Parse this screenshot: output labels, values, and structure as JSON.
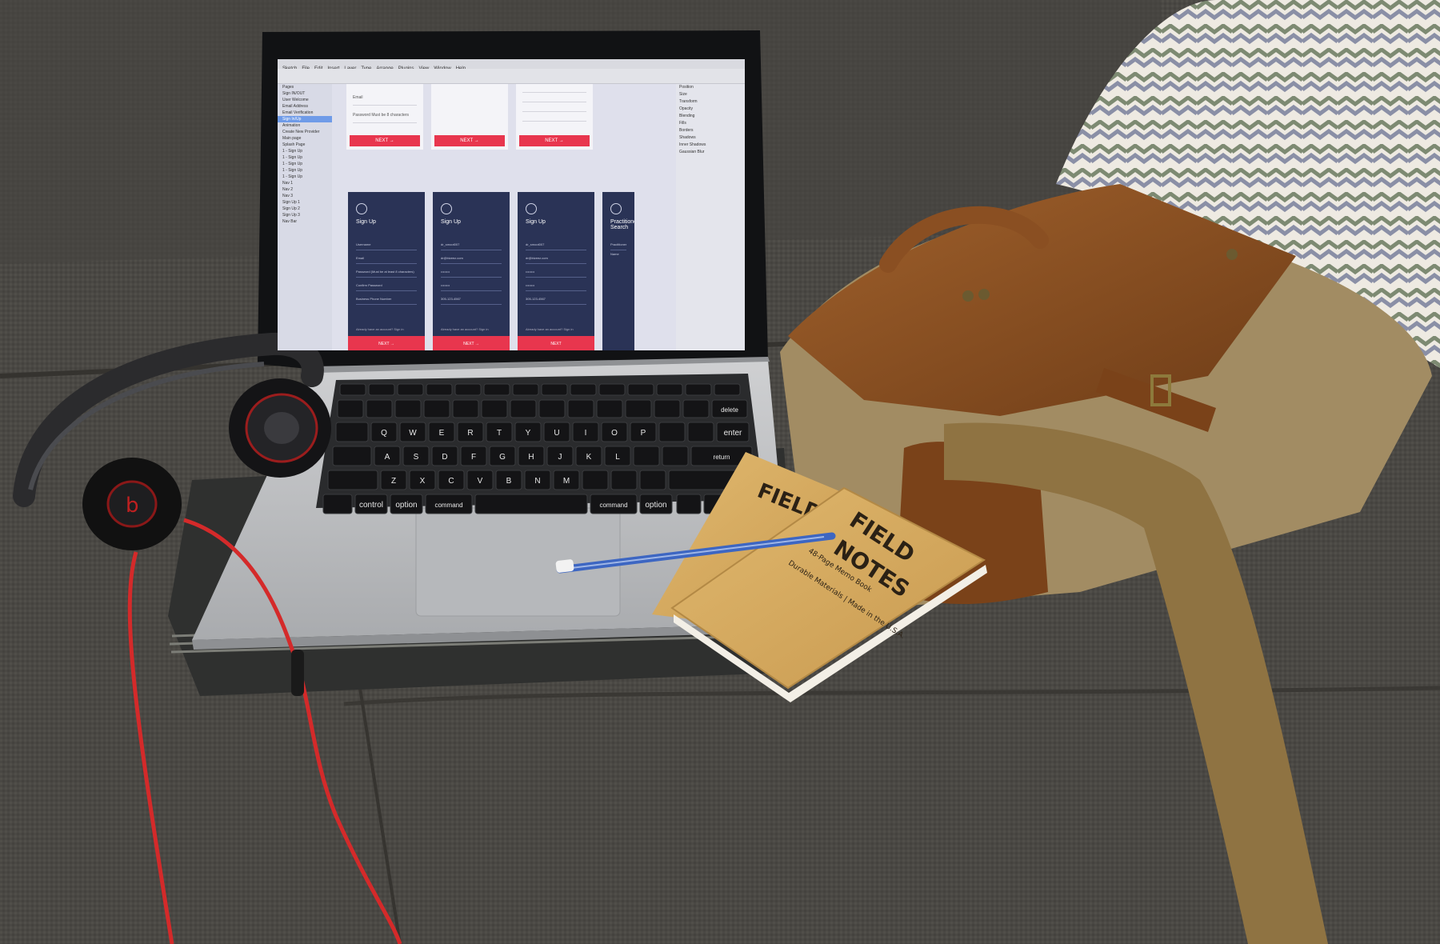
{
  "menubar": {
    "items": [
      "Sketch",
      "File",
      "Edit",
      "Insert",
      "Layer",
      "Type",
      "Arrange",
      "Plugins",
      "View",
      "Window",
      "Help"
    ]
  },
  "layers_panel": {
    "rows": [
      "Pages",
      "Sign IN/OUT",
      "User Welcome",
      "Email Address",
      "Email Verification",
      "Sign In/Up",
      "Animation",
      "Create New Provider",
      "Main page",
      "Splash Page",
      "1 - Sign Up",
      "1 - Sign Up",
      "1 - Sign Up",
      "1 - Sign Up",
      "1 - Sign Up",
      "Nav 1",
      "Nav 2",
      "Nav 3",
      "Sign Up 1",
      "Sign Up 2",
      "Sign Up 3",
      "Nav Bar"
    ],
    "selected_index": 5
  },
  "inspector": {
    "rows": [
      "Position",
      "Size",
      "Transform",
      "Opacity",
      "Blending",
      "Fills",
      "Borders",
      "Shadows",
      "Inner Shadows",
      "Gaussian Blur"
    ]
  },
  "top_artboards": {
    "fields": [
      "Email",
      "Password Must be 8 characters"
    ],
    "button": "NEXT →"
  },
  "artboards": [
    {
      "title": "Sign Up",
      "fields": [
        "Username",
        "Email",
        "Password (Must be at least 8 characters)",
        "Confirm Password",
        "Business Phone Number"
      ],
      "footer": "Already have an account? Sign in",
      "cta": "NEXT →"
    },
    {
      "title": "Sign Up",
      "fields": [
        "dr_smoot007",
        "dr@bizeez.com",
        "••••••••",
        "••••••••",
        "305-123-4567"
      ],
      "footer": "Already have an account? Sign in",
      "cta": "NEXT →"
    },
    {
      "title": "Sign Up",
      "fields": [
        "dr_smoot007",
        "dr@bizeez.com",
        "••••••••",
        "••••••••",
        "305-123-4567"
      ],
      "footer": "Already have an account? Sign in",
      "cta": "NEXT"
    },
    {
      "title": "Practitioner: Search",
      "fields": [
        "Practitioner Name"
      ],
      "footer": "",
      "cta": ""
    }
  ],
  "keyboard": {
    "row_q": [
      "Q",
      "W",
      "E",
      "R",
      "T",
      "Y",
      "U",
      "I",
      "O",
      "P"
    ],
    "row_a": [
      "A",
      "S",
      "D",
      "F",
      "G",
      "H",
      "J",
      "K",
      "L"
    ],
    "row_z": [
      "Z",
      "X",
      "C",
      "V",
      "B",
      "N",
      "M"
    ],
    "mods": [
      "control",
      "option",
      "command",
      "command",
      "option"
    ],
    "delete": "delete",
    "return": "return",
    "enter": "enter"
  },
  "notebooks": {
    "brand_line1": "FIELD",
    "brand_line2": "NOTES",
    "tagline": "48-Page Memo Book",
    "subline": "Durable Materials | Made in the U.S.A."
  },
  "colors": {
    "couch": "#4a4844",
    "artboard_navy": "#2a3356",
    "cta_red": "#e8364e",
    "leather": "#8a4f22",
    "canvas_bag": "#a28c63",
    "notebook_kraft": "#d8ad63",
    "cable_red": "#d42a2a",
    "pen_blue": "#3d66c2"
  }
}
